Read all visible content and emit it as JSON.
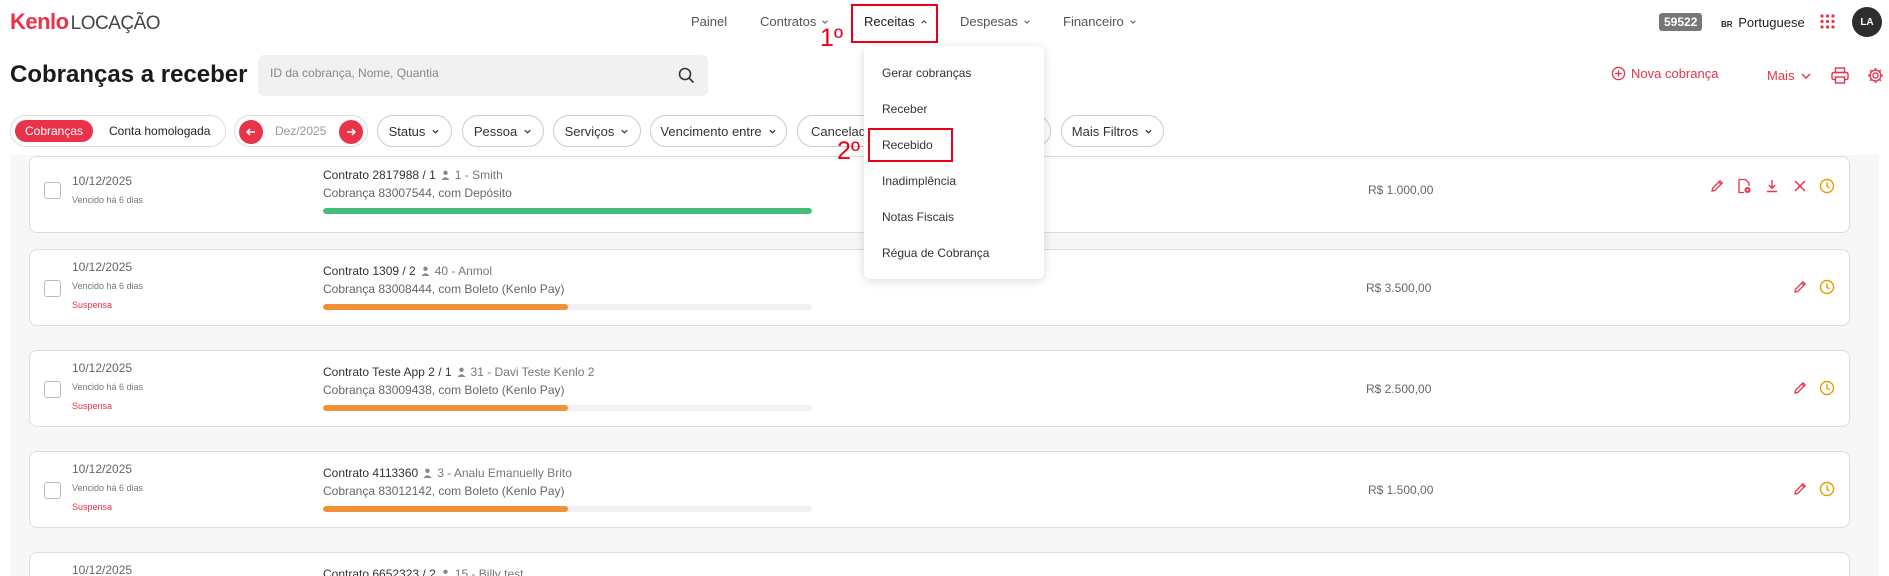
{
  "brand": {
    "kenlo": "Kenlo",
    "product": "LOCAÇÃO"
  },
  "nav": {
    "painel": "Painel",
    "contratos": "Contratos",
    "receitas": "Receitas",
    "despesas": "Despesas",
    "financeiro": "Financeiro"
  },
  "topright": {
    "count_badge": "59522",
    "lang_flag": "BR",
    "language": "Portuguese",
    "avatar": "LA"
  },
  "annotations": {
    "first": "1º",
    "second": "2º"
  },
  "page": {
    "title": "Cobranças a receber"
  },
  "search": {
    "placeholder": "ID da cobrança, Nome, Quantia"
  },
  "actions": {
    "nova_cobranca": "Nova cobrança",
    "mais": "Mais"
  },
  "filters": {
    "segment_active": "Cobranças",
    "segment_inactive": "Conta homologada",
    "month": "Dez/2025",
    "status": "Status",
    "pessoa": "Pessoa",
    "servicos": "Serviços",
    "vencimento": "Vencimento entre",
    "cancelados": "Cancelad",
    "mais_filtros": "Mais Filtros"
  },
  "receitas_menu": [
    "Gerar cobranças",
    "Receber",
    "Recebido",
    "Inadimplência",
    "Notas Fiscais",
    "Régua de Cobrança"
  ],
  "rows": [
    {
      "date": "10/12/2025",
      "overdue": "Vencido há 6 dias",
      "status": "",
      "contract": "Contrato 2817988 / 1",
      "person": "1 - Smith",
      "charge": "Cobrança 83007544, com Depósito",
      "amount": "R$ 1.000,00",
      "progress": 1.0,
      "bar_color": "#44bd7c"
    },
    {
      "date": "10/12/2025",
      "overdue": "Vencido há 6 dias",
      "status": "Suspensa",
      "contract": "Contrato 1309 / 2",
      "person": "40 - Anmol",
      "charge": "Cobrança 83008444, com Boleto (Kenlo Pay)",
      "amount": "R$ 3.500,00",
      "progress": 0.5,
      "bar_color": "#f0913a"
    },
    {
      "date": "10/12/2025",
      "overdue": "Vencido há 6 dias",
      "status": "Suspensa",
      "contract": "Contrato Teste App 2 / 1",
      "person": "31 - Davi Teste Kenlo 2",
      "charge": "Cobrança 83009438, com Boleto (Kenlo Pay)",
      "amount": "R$ 2.500,00",
      "progress": 0.5,
      "bar_color": "#f0913a"
    },
    {
      "date": "10/12/2025",
      "overdue": "Vencido há 6 dias",
      "status": "Suspensa",
      "contract": "Contrato 4113360",
      "person": "3 - Analu Emanuelly Brito",
      "charge": "Cobrança 83012142, com Boleto (Kenlo Pay)",
      "amount": "R$ 1.500,00",
      "progress": 0.5,
      "bar_color": "#f0913a"
    },
    {
      "date": "10/12/2025",
      "overdue": "",
      "status": "",
      "contract": "Contrato 6652323 / 2",
      "person": "15 - Billy test",
      "charge": "",
      "amount": "",
      "progress": 0,
      "bar_color": "#f0913a"
    }
  ],
  "colors": {
    "brand": "#e8334a",
    "annotation": "#e8001c",
    "success": "#44bd7c",
    "warning": "#f0913a",
    "history": "#e0a000"
  }
}
